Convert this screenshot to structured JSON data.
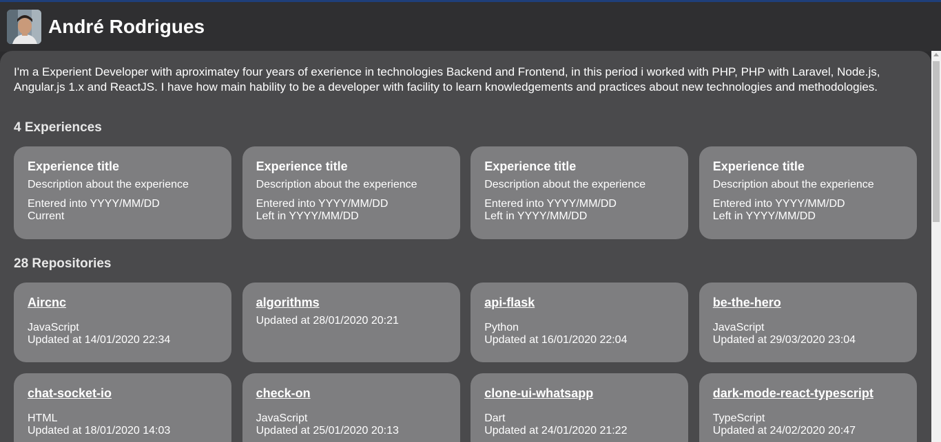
{
  "profile": {
    "name": "André Rodrigues",
    "avatar_icon": "user-photo-icon",
    "bio": "I'm a Experient Developer with aproximatey four years of exerience in technologies Backend and Frontend, in this period i worked with PHP, PHP with Laravel, Node.js, Angular.js 1.x and ReactJS. I have how main hability to be a developer with facility to learn knowledgements and practices about new technologies and methodologies."
  },
  "experiences": {
    "title": "4 Experiences",
    "items": [
      {
        "title": "Experience title",
        "description": "Description about the experience",
        "entered": "Entered into YYYY/MM/DD",
        "left": "Current"
      },
      {
        "title": "Experience title",
        "description": "Description about the experience",
        "entered": "Entered into YYYY/MM/DD",
        "left": "Left in YYYY/MM/DD"
      },
      {
        "title": "Experience title",
        "description": "Description about the experience",
        "entered": "Entered into YYYY/MM/DD",
        "left": "Left in YYYY/MM/DD"
      },
      {
        "title": "Experience title",
        "description": "Description about the experience",
        "entered": "Entered into YYYY/MM/DD",
        "left": "Left in YYYY/MM/DD"
      }
    ]
  },
  "repositories": {
    "title": "28 Repositories",
    "items": [
      {
        "name": "Aircnc",
        "language": "JavaScript",
        "updated": "Updated at 14/01/2020 22:34"
      },
      {
        "name": "algorithms",
        "language": "",
        "updated": "Updated at 28/01/2020 20:21"
      },
      {
        "name": "api-flask",
        "language": "Python",
        "updated": "Updated at 16/01/2020 22:04"
      },
      {
        "name": "be-the-hero",
        "language": "JavaScript",
        "updated": "Updated at 29/03/2020 23:04"
      },
      {
        "name": "chat-socket-io",
        "language": "HTML",
        "updated": "Updated at 18/01/2020 14:03"
      },
      {
        "name": "check-on",
        "language": "JavaScript",
        "updated": "Updated at 25/01/2020 20:13"
      },
      {
        "name": "clone-ui-whatsapp",
        "language": "Dart",
        "updated": "Updated at 24/01/2020 21:22"
      },
      {
        "name": "dark-mode-react-typescript",
        "language": "TypeScript",
        "updated": "Updated at 24/02/2020 20:47"
      }
    ]
  },
  "colors": {
    "page_bg": "#2b2b2d",
    "main_bg": "#4a4a4c",
    "card_bg": "#7e7e80",
    "text": "#ffffff",
    "top_accent": "#1f3f7a"
  }
}
